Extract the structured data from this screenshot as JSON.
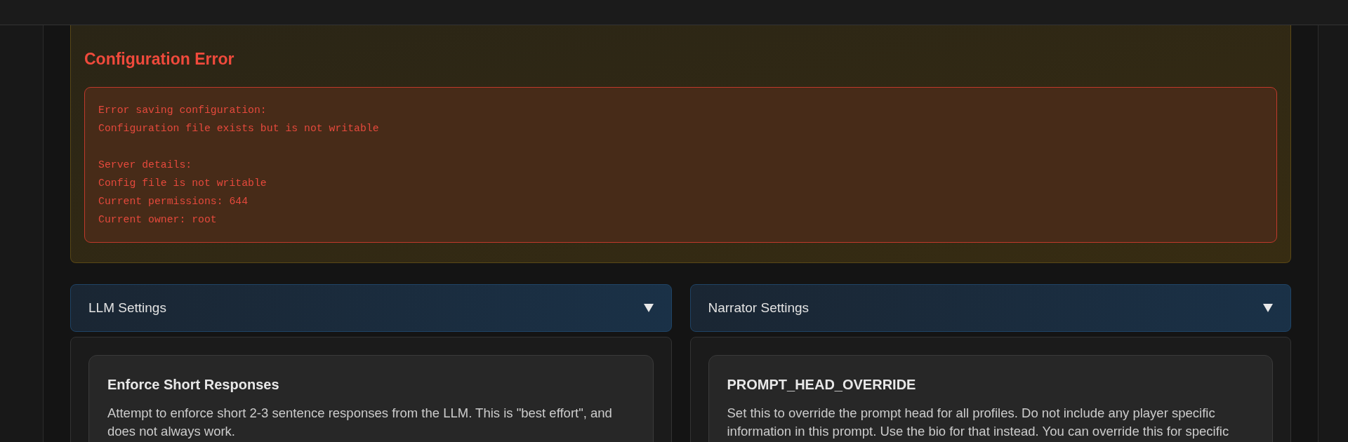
{
  "error_card": {
    "title": "Configuration Error",
    "message_groups": [
      [
        "Error saving configuration:",
        "Configuration file exists but is not writable"
      ],
      [
        "Server details:",
        "Config file is not writable",
        "Current permissions: 644",
        "Current owner: root"
      ]
    ]
  },
  "sections": [
    {
      "title": "LLM Settings",
      "expanded": true,
      "settings": [
        {
          "name": "Enforce Short Responses",
          "description_lines": [
            "Attempt to enforce short 2-3 sentence responses from the LLM. This is \"best effort\", and",
            "does not always work."
          ]
        }
      ]
    },
    {
      "title": "Narrator Settings",
      "expanded": true,
      "settings": [
        {
          "name": "PROMPT_HEAD_OVERRIDE",
          "description_lines": [
            "Set this to override the prompt head for all profiles. Do not include any player specific",
            "information in this prompt. Use the bio for that instead. You can override this for specific"
          ]
        }
      ]
    }
  ]
}
